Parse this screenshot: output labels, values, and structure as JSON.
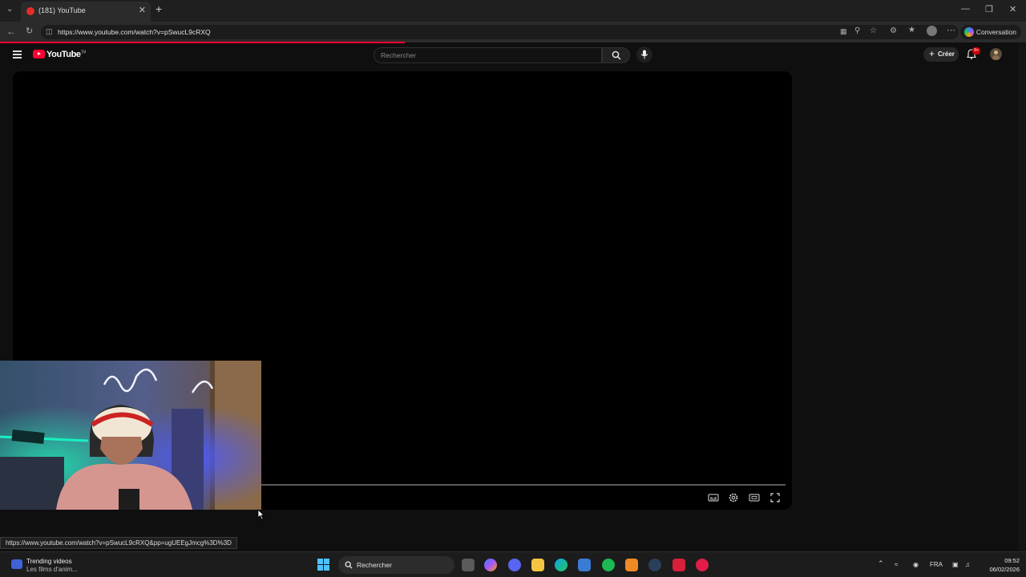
{
  "browser": {
    "tab_title": "(181) YouTube",
    "url": "https://www.youtube.com/watch?v=pSwucL9cRXQ",
    "copilot_label": "Conversation"
  },
  "youtube": {
    "logo_text": "YouTube",
    "logo_tm": "TM",
    "search_placeholder": "Rechercher",
    "create_label": "Créer",
    "notification_badge": "9+"
  },
  "status_link": "https://www.youtube.com/watch?v=pSwucL9cRXQ&pp=ugUEEgJmcg%3D%3D",
  "taskbar": {
    "widget_title": "Trending videos",
    "widget_subtitle": "Les films d'anim...",
    "search_label": "Rechercher",
    "language": "FRA",
    "time": "09:52",
    "date": "06/02/2026"
  },
  "colors": {
    "youtube_red": "#ff0033",
    "windows_blue": "#4cc2ff"
  }
}
